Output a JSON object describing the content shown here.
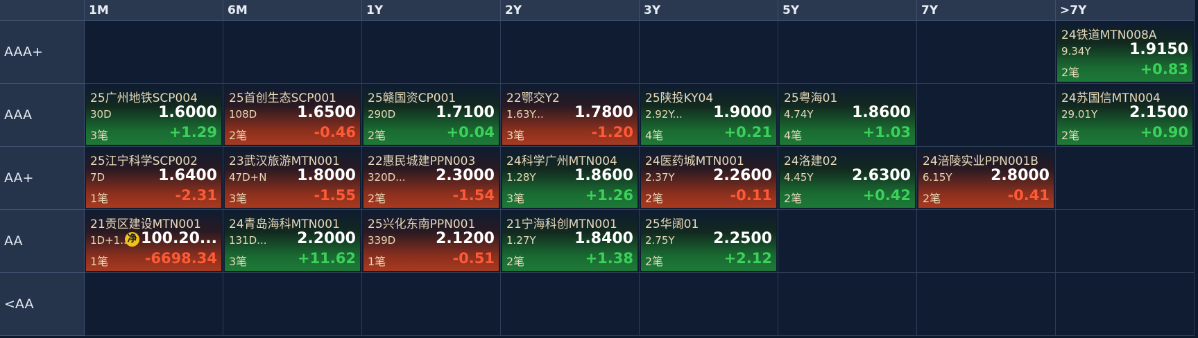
{
  "columns": [
    "1M",
    "6M",
    "1Y",
    "2Y",
    "3Y",
    "5Y",
    "7Y",
    ">7Y"
  ],
  "rows": [
    "AAA+",
    "AAA",
    "AA+",
    "AA",
    "<AA"
  ],
  "bonds": [
    {
      "row": 0,
      "col": 7,
      "name": "24铁道MTN008A",
      "term": "9.34Y",
      "price": "1.9150",
      "count": "2笔",
      "change": "+0.83",
      "dir": "up"
    },
    {
      "row": 1,
      "col": 0,
      "name": "25广州地铁SCP004",
      "term": "30D",
      "price": "1.6000",
      "count": "3笔",
      "change": "+1.29",
      "dir": "up"
    },
    {
      "row": 1,
      "col": 1,
      "name": "25首创生态SCP001",
      "term": "108D",
      "price": "1.6500",
      "count": "2笔",
      "change": "-0.46",
      "dir": "down"
    },
    {
      "row": 1,
      "col": 2,
      "name": "25赣国资CP001",
      "term": "290D",
      "price": "1.7100",
      "count": "2笔",
      "change": "+0.04",
      "dir": "up"
    },
    {
      "row": 1,
      "col": 3,
      "name": "22鄂交Y2",
      "term": "1.63Y...",
      "price": "1.7800",
      "count": "3笔",
      "change": "-1.20",
      "dir": "down"
    },
    {
      "row": 1,
      "col": 4,
      "name": "25陕投KY04",
      "term": "2.92Y...",
      "price": "1.9000",
      "count": "4笔",
      "change": "+0.21",
      "dir": "up"
    },
    {
      "row": 1,
      "col": 5,
      "name": "25粤海01",
      "term": "4.74Y",
      "price": "1.8600",
      "count": "4笔",
      "change": "+1.03",
      "dir": "up"
    },
    {
      "row": 1,
      "col": 7,
      "name": "24苏国信MTN004",
      "term": "29.01Y",
      "price": "2.1500",
      "count": "2笔",
      "change": "+0.90",
      "dir": "up"
    },
    {
      "row": 2,
      "col": 0,
      "name": "25江宁科学SCP002",
      "term": "7D",
      "price": "1.6400",
      "count": "1笔",
      "change": "-2.31",
      "dir": "down"
    },
    {
      "row": 2,
      "col": 1,
      "name": "23武汉旅游MTN001",
      "term": "47D+N",
      "price": "1.8000",
      "count": "3笔",
      "change": "-1.55",
      "dir": "down"
    },
    {
      "row": 2,
      "col": 2,
      "name": "22惠民城建PPN003",
      "term": "320D...",
      "price": "2.3000",
      "count": "2笔",
      "change": "-1.54",
      "dir": "down"
    },
    {
      "row": 2,
      "col": 3,
      "name": "24科学广州MTN004",
      "term": "1.28Y",
      "price": "1.8600",
      "count": "3笔",
      "change": "+1.26",
      "dir": "up"
    },
    {
      "row": 2,
      "col": 4,
      "name": "24医药城MTN001",
      "term": "2.37Y",
      "price": "2.2600",
      "count": "2笔",
      "change": "-0.11",
      "dir": "down"
    },
    {
      "row": 2,
      "col": 5,
      "name": "24洛建02",
      "term": "4.45Y",
      "price": "2.6300",
      "count": "2笔",
      "change": "+0.42",
      "dir": "up"
    },
    {
      "row": 2,
      "col": 6,
      "name": "24涪陵实业PPN001B",
      "term": "6.15Y",
      "price": "2.8000",
      "count": "2笔",
      "change": "-0.41",
      "dir": "down"
    },
    {
      "row": 3,
      "col": 0,
      "name": "21贡区建设MTN001",
      "term": "1D+1....",
      "price": "100.20...",
      "count": "1笔",
      "change": "-6698.34",
      "dir": "down",
      "badge": "净"
    },
    {
      "row": 3,
      "col": 1,
      "name": "24青岛海科MTN001",
      "term": "131D...",
      "price": "2.2000",
      "count": "3笔",
      "change": "+11.62",
      "dir": "up"
    },
    {
      "row": 3,
      "col": 2,
      "name": "25兴化东南PPN001",
      "term": "339D",
      "price": "2.1200",
      "count": "1笔",
      "change": "-0.51",
      "dir": "down"
    },
    {
      "row": 3,
      "col": 3,
      "name": "21宁海科创MTN001",
      "term": "1.27Y",
      "price": "1.8400",
      "count": "2笔",
      "change": "+1.38",
      "dir": "up"
    },
    {
      "row": 3,
      "col": 4,
      "name": "25华阔01",
      "term": "2.75Y",
      "price": "2.2500",
      "count": "2笔",
      "change": "+2.12",
      "dir": "up"
    }
  ]
}
